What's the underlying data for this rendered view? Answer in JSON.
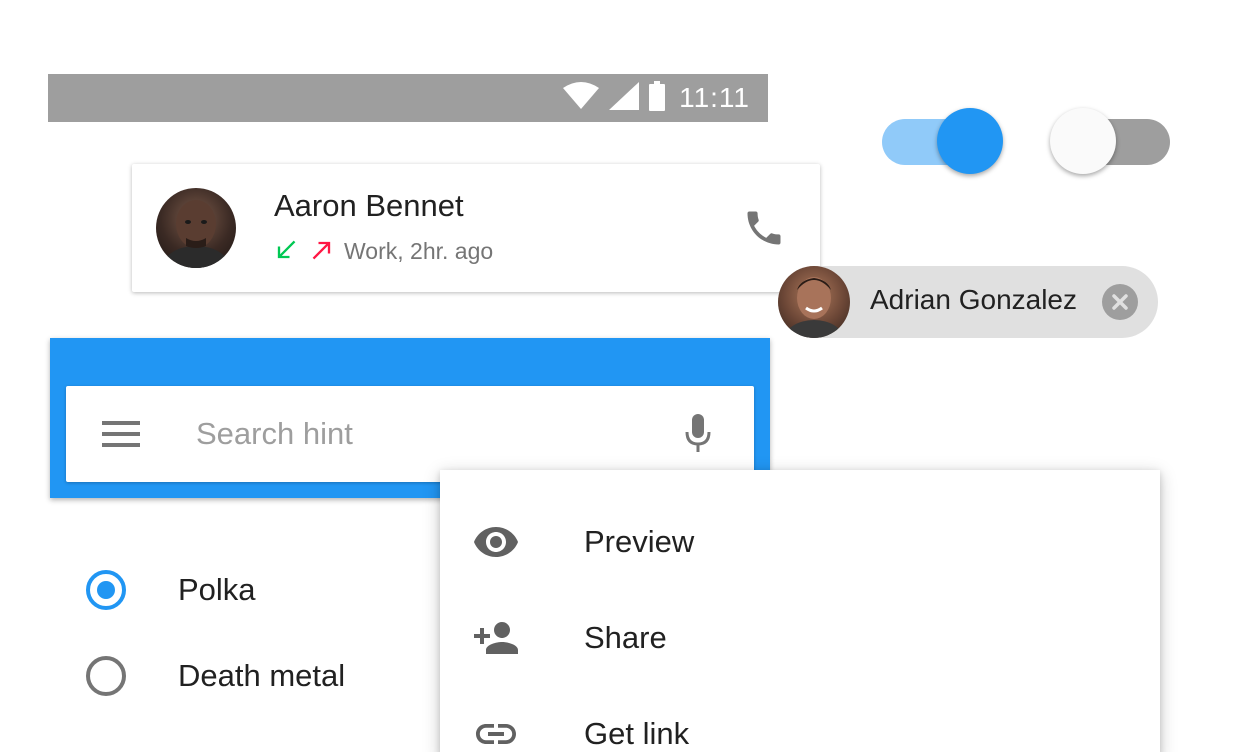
{
  "status_bar": {
    "time": "11:11",
    "icons": [
      "wifi-icon",
      "signal-icon",
      "battery-icon"
    ],
    "background": "#9e9e9e"
  },
  "switches": [
    {
      "name": "switch-on",
      "state": "on",
      "accent": "#2196f3"
    },
    {
      "name": "switch-off",
      "state": "off"
    }
  ],
  "contact_card": {
    "name": "Aaron Bennet",
    "meta": "Work, 2hr. ago",
    "icons": [
      "incoming-call-icon",
      "outgoing-call-icon",
      "phone-icon"
    ],
    "incoming_color": "#00c853",
    "outgoing_color": "#ff1744"
  },
  "chip": {
    "label": "Adrian Gonzalez",
    "icons": [
      "chip-close-icon"
    ]
  },
  "search": {
    "placeholder": "Search hint",
    "value": "",
    "icons": [
      "hamburger-menu-icon",
      "mic-icon"
    ],
    "bar_color": "#2196f3"
  },
  "radio_group": {
    "options": [
      {
        "label": "Polka",
        "checked": true
      },
      {
        "label": "Death metal",
        "checked": false
      }
    ]
  },
  "menu": {
    "items": [
      {
        "label": "Preview",
        "icon": "eye-icon"
      },
      {
        "label": "Share",
        "icon": "person-add-icon"
      },
      {
        "label": "Get link",
        "icon": "link-icon"
      }
    ]
  }
}
